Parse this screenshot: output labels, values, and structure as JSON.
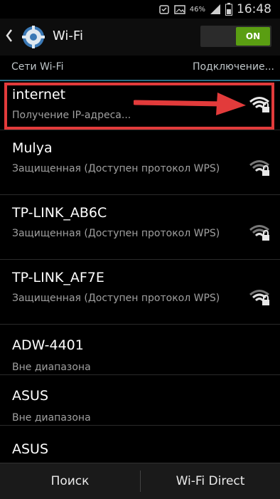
{
  "status_bar": {
    "battery": "46%",
    "time": "16:48"
  },
  "action_bar": {
    "title": "Wi-Fi",
    "toggle_label": "ON"
  },
  "section": {
    "left": "Сети Wi-Fi",
    "right": "Подключение..."
  },
  "networks": [
    {
      "name": "internet",
      "status": "Получение IP-адреса...",
      "icon": "wifi-lock-icon",
      "highlighted": true
    },
    {
      "name": "Mulya",
      "status": "Защищенная (Доступен протокол WPS)",
      "icon": "wifi-lock-icon"
    },
    {
      "name": "TP-LINK_AB6C",
      "status": "Защищенная (Доступен протокол WPS)",
      "icon": "wifi-lock-icon"
    },
    {
      "name": "TP-LINK_AF7E",
      "status": "Защищенная (Доступен протокол WPS)",
      "icon": "wifi-lock-icon"
    },
    {
      "name": "ADW-4401",
      "status": "Вне диапазона"
    },
    {
      "name": "ASUS",
      "status": "Вне диапазона"
    },
    {
      "name": "ASUS",
      "status": ""
    }
  ],
  "bottom_bar": {
    "search": "Поиск",
    "wifi_direct": "Wi-Fi Direct"
  },
  "colors": {
    "highlight": "#e23b3b",
    "toggle_on": "#5a9e12",
    "divider": "#2c6e85"
  }
}
